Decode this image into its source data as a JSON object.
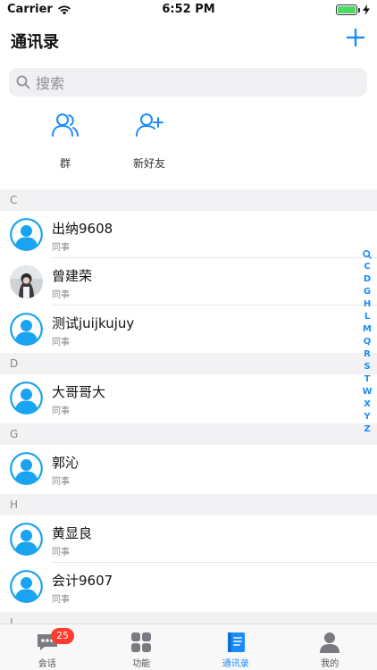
{
  "status": {
    "carrier": "Carrier",
    "time": "6:52 PM"
  },
  "nav": {
    "title": "通讯录"
  },
  "search": {
    "placeholder": "搜索"
  },
  "quick_actions": [
    {
      "label": "群",
      "icon": "group-icon"
    },
    {
      "label": "新好友",
      "icon": "add-friend-icon"
    }
  ],
  "sections": [
    {
      "letter": "C",
      "contacts": [
        {
          "name": "出纳9608",
          "role": "同事"
        },
        {
          "name": "曾建荣",
          "role": "同事"
        },
        {
          "name": "测试juijkujuy",
          "role": "同事"
        }
      ]
    },
    {
      "letter": "D",
      "contacts": [
        {
          "name": "大哥哥大",
          "role": "同事"
        }
      ]
    },
    {
      "letter": "G",
      "contacts": [
        {
          "name": "郭沁",
          "role": "同事"
        }
      ]
    },
    {
      "letter": "H",
      "contacts": [
        {
          "name": "黄显良",
          "role": "同事"
        },
        {
          "name": "会计9607",
          "role": "同事"
        }
      ]
    },
    {
      "letter": "J",
      "contacts": []
    }
  ],
  "index_letters": [
    "C",
    "D",
    "G",
    "H",
    "L",
    "M",
    "Q",
    "R",
    "S",
    "T",
    "W",
    "X",
    "Y",
    "Z"
  ],
  "tabs": [
    {
      "label": "会话",
      "badge": "25"
    },
    {
      "label": "功能"
    },
    {
      "label": "通讯录"
    },
    {
      "label": "我的"
    }
  ],
  "colors": {
    "accent": "#1a8cff",
    "avatar_blue": "#1aa3f0",
    "badge_red": "#ff3b30"
  }
}
